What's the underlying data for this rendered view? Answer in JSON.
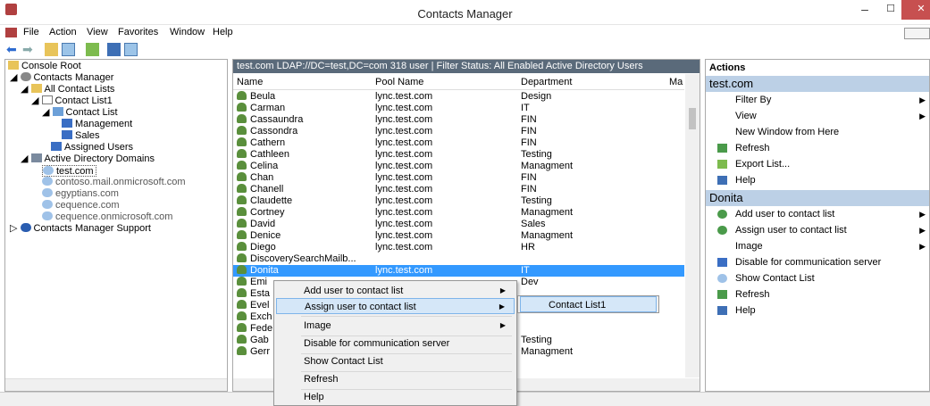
{
  "window": {
    "title": "Contacts Manager",
    "minimize": "–",
    "maximize": "☐",
    "close": "✕"
  },
  "menubar": [
    "File",
    "Action",
    "View",
    "Favorites",
    "Window",
    "Help"
  ],
  "tree": [
    {
      "label": "Console Root"
    },
    {
      "label": "Contacts Manager"
    },
    {
      "label": "All Contact Lists"
    },
    {
      "label": "Contact List1"
    },
    {
      "label": "Contact List"
    },
    {
      "label": "Management"
    },
    {
      "label": "Sales"
    },
    {
      "label": "Assigned Users"
    },
    {
      "label": "Active Directory Domains"
    },
    {
      "label": "test.com"
    },
    {
      "label": "contoso.mail.onmicrosoft.com"
    },
    {
      "label": "egyptians.com"
    },
    {
      "label": "cequence.com"
    },
    {
      "label": "cequence.onmicrosoft.com"
    },
    {
      "label": "Contacts Manager Support"
    }
  ],
  "center": {
    "info": "test.com   LDAP://DC=test,DC=com 318 user  | Filter Status: All Enabled Active Directory Users",
    "columns": [
      "Name",
      "Pool Name",
      "Department",
      "Ma"
    ],
    "rows": [
      {
        "name": "Beula",
        "pool": "lync.test.com",
        "dept": "Design"
      },
      {
        "name": "Carman",
        "pool": "lync.test.com",
        "dept": "IT"
      },
      {
        "name": "Cassaundra",
        "pool": "lync.test.com",
        "dept": "FIN"
      },
      {
        "name": "Cassondra",
        "pool": "lync.test.com",
        "dept": "FIN"
      },
      {
        "name": "Cathern",
        "pool": "lync.test.com",
        "dept": "FIN"
      },
      {
        "name": "Cathleen",
        "pool": "lync.test.com",
        "dept": "Testing"
      },
      {
        "name": "Celina",
        "pool": "lync.test.com",
        "dept": "Managment"
      },
      {
        "name": "Chan",
        "pool": "lync.test.com",
        "dept": "FIN"
      },
      {
        "name": "Chanell",
        "pool": "lync.test.com",
        "dept": "FIN"
      },
      {
        "name": "Claudette",
        "pool": "lync.test.com",
        "dept": "Testing"
      },
      {
        "name": "Cortney",
        "pool": "lync.test.com",
        "dept": "Managment"
      },
      {
        "name": "David",
        "pool": "lync.test.com",
        "dept": "Sales"
      },
      {
        "name": "Denice",
        "pool": "lync.test.com",
        "dept": "Managment"
      },
      {
        "name": "Diego",
        "pool": "lync.test.com",
        "dept": "HR"
      },
      {
        "name": "DiscoverySearchMailb...",
        "pool": "",
        "dept": ""
      },
      {
        "name": "Donita",
        "pool": "lync.test.com",
        "dept": "IT"
      },
      {
        "name": "Emi",
        "pool": "",
        "dept": "Dev"
      },
      {
        "name": "Esta",
        "pool": "",
        "dept": ""
      },
      {
        "name": "Evel",
        "pool": "",
        "dept": "Dev"
      },
      {
        "name": "Exch",
        "pool": "",
        "dept": ""
      },
      {
        "name": "Fede",
        "pool": "",
        "dept": ""
      },
      {
        "name": "Gab",
        "pool": "",
        "dept": "Testing"
      },
      {
        "name": "Gerr",
        "pool": "",
        "dept": "Managment"
      }
    ]
  },
  "actions": {
    "header": "Actions",
    "section1": "test.com",
    "items1": [
      "Filter By",
      "View",
      "New Window from Here",
      "Refresh",
      "Export List...",
      "Help"
    ],
    "section2": "Donita",
    "items2": [
      "Add user to contact list",
      "Assign user to contact list",
      "Image",
      "Disable for communication server",
      "Show Contact List",
      "Refresh",
      "Help"
    ]
  },
  "context_menu": {
    "items": [
      "Add user to contact list",
      "Assign user to contact list",
      "Image",
      "Disable for communication server",
      "Show Contact List",
      "Refresh",
      "Help"
    ],
    "submenu": [
      "Contact List1"
    ]
  },
  "colors": {
    "selection": "#3399ff",
    "menu_highlight": "#d5e7f8",
    "section_bar": "#bcd0e6",
    "close": "#c75050"
  }
}
